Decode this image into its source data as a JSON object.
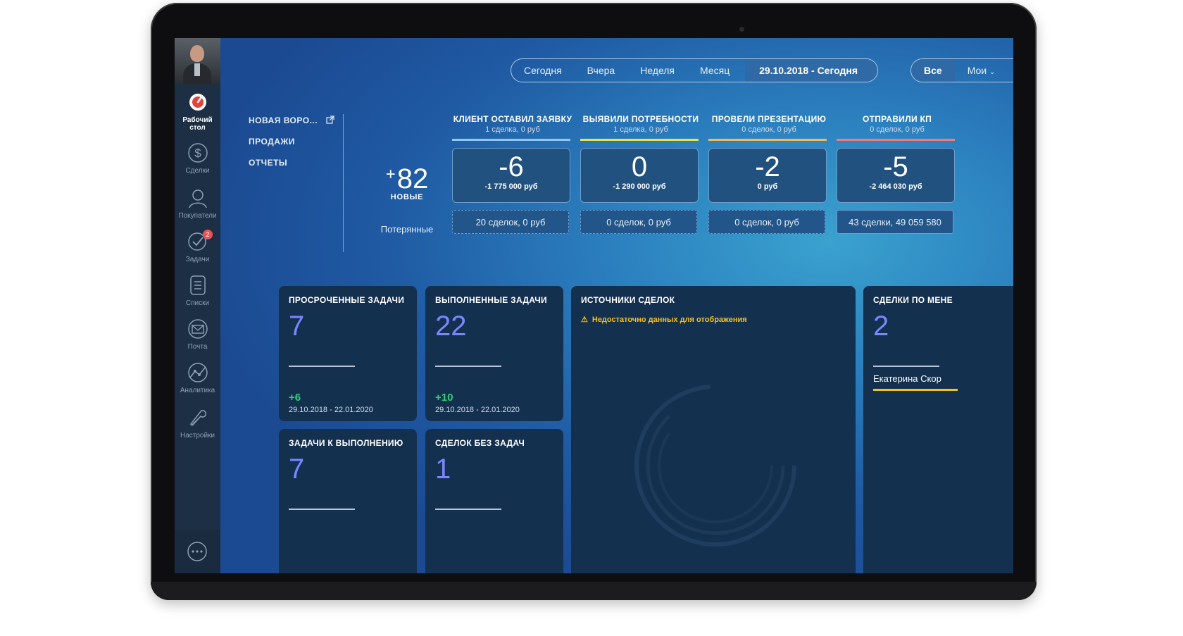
{
  "sidebar": {
    "items": [
      {
        "label": "Рабочий стол",
        "icon": "dashboard-icon",
        "active": true
      },
      {
        "label": "Сделки",
        "icon": "dollar-icon"
      },
      {
        "label": "Покупатели",
        "icon": "customers-icon"
      },
      {
        "label": "Задачи",
        "icon": "tasks-icon",
        "badge": "2"
      },
      {
        "label": "Списки",
        "icon": "lists-icon"
      },
      {
        "label": "Почта",
        "icon": "mail-icon"
      },
      {
        "label": "Аналитика",
        "icon": "analytics-icon"
      },
      {
        "label": "Настройки",
        "icon": "settings-icon"
      }
    ]
  },
  "filter": {
    "periods": [
      "Сегодня",
      "Вчера",
      "Неделя",
      "Месяц"
    ],
    "selected_range": "29.10.2018 - Сегодня",
    "scope": [
      "Все",
      "Мои"
    ]
  },
  "pipeline_menu": {
    "items": [
      "НОВАЯ ВОРО...",
      "ПРОДАЖИ",
      "ОТЧЕТЫ"
    ]
  },
  "summary": {
    "new_sign": "+",
    "new_value": "82",
    "new_label": "НОВЫЕ",
    "lost_label": "Потерянные"
  },
  "stages": [
    {
      "title": "КЛИЕНТ ОСТАВИЛ ЗАЯВКУ",
      "sub": "1 сделка, 0 руб",
      "value": "-6",
      "amount": "-1 775 000 руб",
      "lost": "20 сделок, 0 руб",
      "color": "#8fc7f2"
    },
    {
      "title": "ВЫЯВИЛИ ПОТРЕБНОСТИ",
      "sub": "1 сделка, 0 руб",
      "value": "0",
      "amount": "-1 290 000 руб",
      "lost": "0 сделок, 0 руб",
      "color": "#e8e24a"
    },
    {
      "title": "ПРОВЕЛИ ПРЕЗЕНТАЦИЮ",
      "sub": "0 сделок, 0 руб",
      "value": "-2",
      "amount": "0 руб",
      "lost": "0 сделок, 0 руб",
      "color": "#f2b85a"
    },
    {
      "title": "ОТПРАВИЛИ КП",
      "sub": "0 сделок, 0 руб",
      "value": "-5",
      "amount": "-2 464 030 руб",
      "lost": "43 сделки, 49 059 580",
      "color": "#f27a7a"
    }
  ],
  "cards": {
    "overdue": {
      "title": "ПРОСРОЧЕННЫЕ ЗАДАЧИ",
      "value": "7",
      "delta": "+6",
      "range": "29.10.2018 - 22.01.2020"
    },
    "done": {
      "title": "ВЫПОЛНЕННЫЕ ЗАДАЧИ",
      "value": "22",
      "delta": "+10",
      "range": "29.10.2018 - 22.01.2020"
    },
    "todo": {
      "title": "ЗАДАЧИ К ВЫПОЛНЕНИЮ",
      "value": "7"
    },
    "no_tasks": {
      "title": "СДЕЛОК БЕЗ ЗАДАЧ",
      "value": "1"
    },
    "sources": {
      "title": "ИСТОЧНИКИ СДЕЛОК",
      "warning": "Недостаточно данных для отображения"
    },
    "managers": {
      "title": "СДЕЛКИ ПО МЕНЕ",
      "value": "2",
      "name": "Екатерина Скор"
    }
  },
  "colors": {
    "accent": "#7a86ff",
    "positive": "#33d17a",
    "warning": "#f4c020",
    "card_bg": "#14304f"
  }
}
